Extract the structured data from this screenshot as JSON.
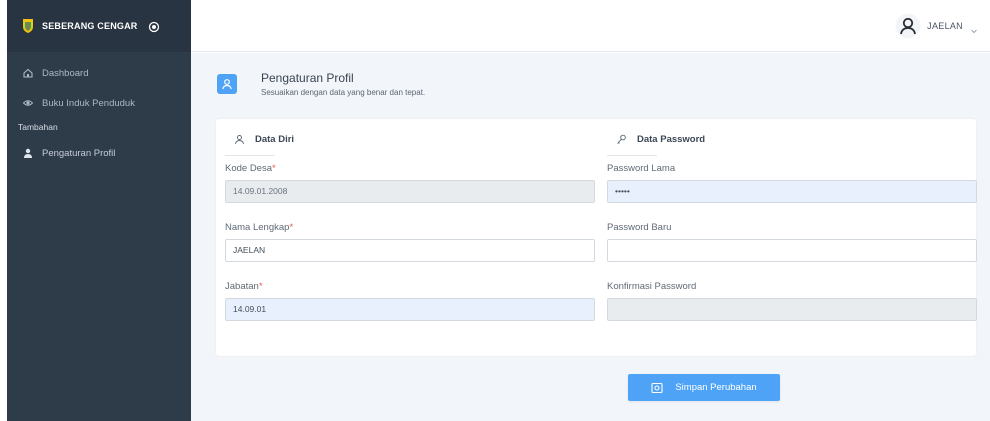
{
  "brand": {
    "name": "SEBERANG CENGAR",
    "logo_icon": "shield-logo",
    "toggle_icon": "toggle-circle-icon"
  },
  "sidebar": {
    "items": [
      {
        "label": "Dashboard",
        "icon": "home-icon"
      },
      {
        "label": "Buku Induk Penduduk",
        "icon": "eye-icon"
      }
    ],
    "section_header": "Tambahan",
    "extra_items": [
      {
        "label": "Pengaturan Profil",
        "icon": "user-icon"
      }
    ]
  },
  "topbar": {
    "user_name": "JAELAN",
    "avatar_icon": "user-outline-icon",
    "caret_icon": "chevron-down-icon"
  },
  "page": {
    "title": "Pengaturan Profil",
    "subtitle": "Sesuaikan dengan data yang benar dan tepat.",
    "icon": "user-icon"
  },
  "data_diri": {
    "heading": "Data Diri",
    "kode_desa": {
      "label": "Kode Desa",
      "value": "14.09.01.2008"
    },
    "nama_lengkap": {
      "label": "Nama Lengkap",
      "value": "JAELAN"
    },
    "jabatan": {
      "label": "Jabatan",
      "value": "14.09.01"
    },
    "required_mark": "*"
  },
  "data_password": {
    "heading": "Data Password",
    "password_lama": {
      "label": "Password Lama",
      "value": "•••••"
    },
    "password_baru": {
      "label": "Password Baru",
      "value": ""
    },
    "konfirmasi": {
      "label": "Konfirmasi Password",
      "value": ""
    }
  },
  "actions": {
    "save_label": "Simpan Perubahan",
    "save_icon": "save-icon"
  },
  "colors": {
    "sidebar": "#2e3b49",
    "accent": "#4fa3f7",
    "background": "#f2f5f9",
    "required": "#e85a5a"
  }
}
